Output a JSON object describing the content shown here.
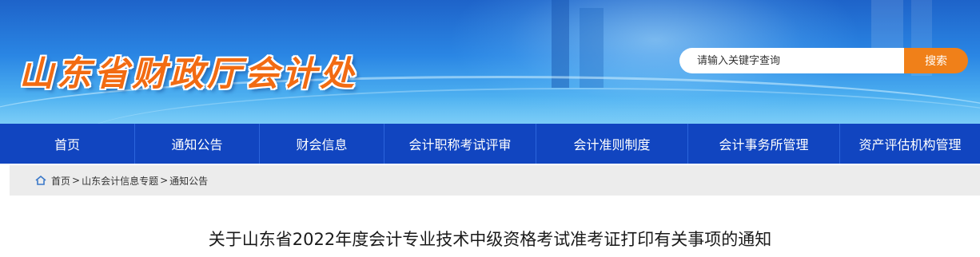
{
  "site": {
    "title": "山东省财政厅会计处"
  },
  "search": {
    "placeholder": "请输入关键字查询",
    "button_label": "搜索"
  },
  "nav": {
    "items": [
      {
        "label": "首页"
      },
      {
        "label": "通知公告"
      },
      {
        "label": "财会信息"
      },
      {
        "label": "会计职称考试评审"
      },
      {
        "label": "会计准则制度"
      },
      {
        "label": "会计事务所管理"
      },
      {
        "label": "资产评估机构管理"
      }
    ]
  },
  "breadcrumb": {
    "icon": "home-icon",
    "items": [
      "首页",
      "山东会计信息专题",
      "通知公告"
    ],
    "separator": ">"
  },
  "article": {
    "title": "关于山东省2022年度会计专业技术中级资格考试准考证打印有关事项的通知"
  },
  "colors": {
    "nav_bg": "#1145c0",
    "accent": "#f08019",
    "title_orange": "#f26b12"
  }
}
